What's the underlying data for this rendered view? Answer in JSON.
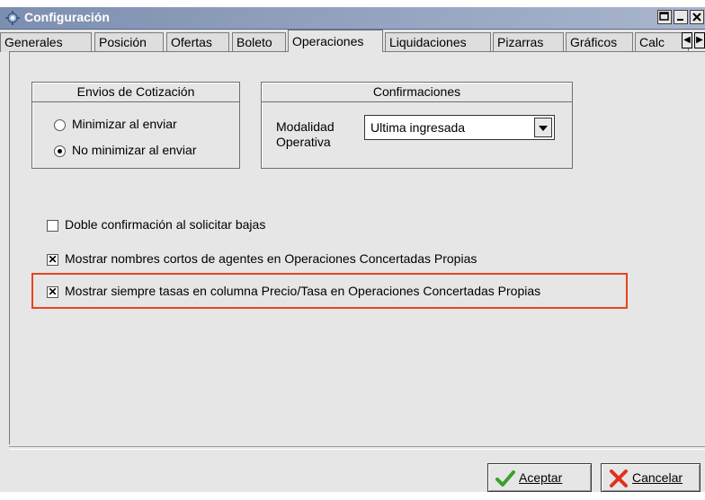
{
  "window": {
    "title": "Configuración"
  },
  "titlebar_buttons": [
    "maximize",
    "minimize",
    "close"
  ],
  "tabs": [
    {
      "label": "Generales"
    },
    {
      "label": "Posición"
    },
    {
      "label": "Ofertas"
    },
    {
      "label": "Boleto"
    },
    {
      "label": "Operaciones",
      "active": true
    },
    {
      "label": "Liquidaciones"
    },
    {
      "label": "Pizarras"
    },
    {
      "label": "Gráficos"
    },
    {
      "label": "Calc"
    }
  ],
  "envios": {
    "title": "Envios de Cotización",
    "options": [
      {
        "label": "Minimizar al enviar",
        "selected": false
      },
      {
        "label": "No minimizar al enviar",
        "selected": true
      }
    ]
  },
  "confirmaciones": {
    "title": "Confirmaciones",
    "modalidad_label_1": "Modalidad",
    "modalidad_label_2": "Operativa",
    "modalidad_value": "Ultima ingresada"
  },
  "checks": [
    {
      "label": "Doble confirmación al solicitar bajas",
      "checked": false
    },
    {
      "label": "Mostrar nombres cortos de agentes en Operaciones Concertadas Propias",
      "checked": true
    },
    {
      "label": "Mostrar siempre tasas en columna Precio/Tasa en Operaciones Concertadas Propias",
      "checked": true
    }
  ],
  "footer": {
    "accept_label": "Aceptar",
    "cancel_label": "Cancelar"
  },
  "colors": {
    "highlight": "#e8431f",
    "titlebar": "#7d8fb0",
    "accept_icon": "#3aa02a",
    "cancel_icon": "#e0301e"
  }
}
